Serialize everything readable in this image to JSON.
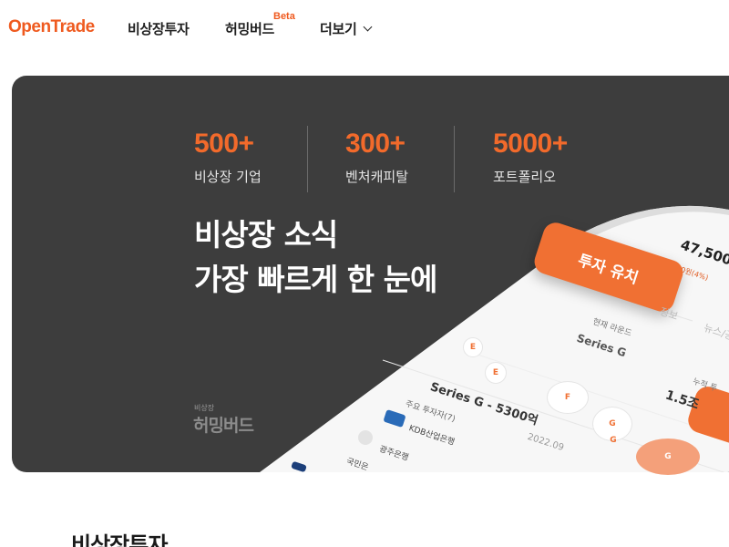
{
  "header": {
    "logo": "OpenTrade",
    "nav": [
      {
        "label": "비상장투자"
      },
      {
        "label": "허밍버드",
        "badge": "Beta"
      },
      {
        "label": "더보기"
      }
    ]
  },
  "hero": {
    "stats": [
      {
        "number": "500+",
        "label": "비상장 기업"
      },
      {
        "number": "300+",
        "label": "벤처캐피탈"
      },
      {
        "number": "5000+",
        "label": "포트폴리오"
      }
    ],
    "headline_line1": "비상장 소식",
    "headline_line2": "가장 빠르게 한 눈에",
    "brand_small": "비상장",
    "brand_logo": "허밍버드"
  },
  "phone": {
    "price": "47,500",
    "change": "▲ 100원(4%)",
    "invest_pill": "투자 유치",
    "tab_info": "정보",
    "tab_news": "뉴스/공",
    "current_round_label": "현재 라운드",
    "current_round_value": "Series G",
    "cumulative_label": "누적 투",
    "cumulative_value": "1.5조",
    "round_title": "Series G - 5300억",
    "round_date": "2022.09",
    "investors_label": "주요 투자자(7)",
    "investor1": "KDB산업은행",
    "investor2": "광주은행",
    "investor3": "국민은",
    "node_e1": "E",
    "node_e2": "E",
    "node_f": "F",
    "node_g1": "G",
    "node_g2": "G",
    "node_g3": "G"
  },
  "section": {
    "title": "비상장투자"
  },
  "colors": {
    "accent": "#ef5a1f",
    "hero_bg": "#3d3d3d"
  }
}
